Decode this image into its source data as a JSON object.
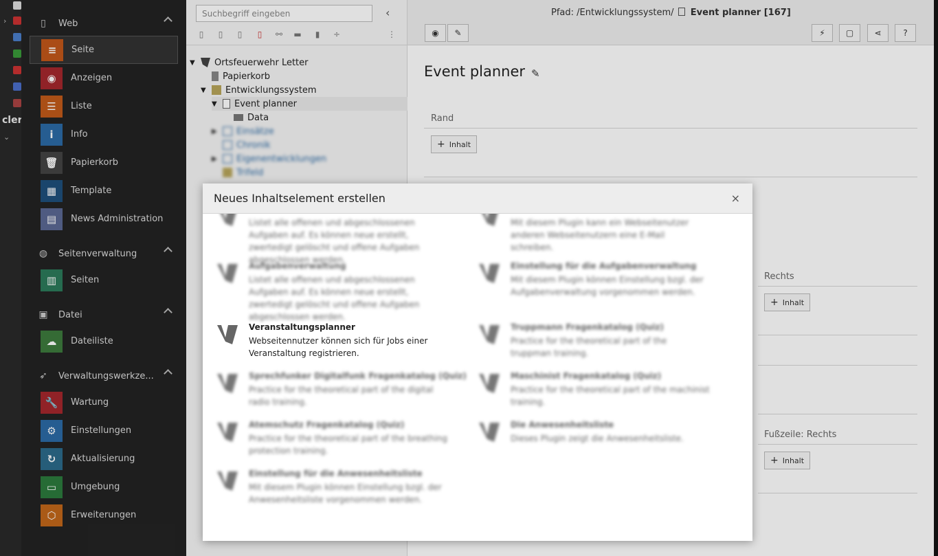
{
  "desktop": {
    "label": "cler"
  },
  "sidebar": {
    "groups": [
      {
        "label": "Web",
        "items": [
          {
            "label": "Seite",
            "color": "#c2571a",
            "active": true
          },
          {
            "label": "Anzeigen",
            "color": "#a4272d"
          },
          {
            "label": "Liste",
            "color": "#c25a1a"
          },
          {
            "label": "Info",
            "color": "#2c6aa5"
          },
          {
            "label": "Papierkorb",
            "color": "#444444"
          },
          {
            "label": "Template",
            "color": "#1e4f7b"
          },
          {
            "label": "News Administration",
            "color": "#5a6893"
          }
        ]
      },
      {
        "label": "Seitenverwaltung",
        "items": [
          {
            "label": "Seiten",
            "color": "#2c7a5a"
          }
        ]
      },
      {
        "label": "Datei",
        "items": [
          {
            "label": "Dateiliste",
            "color": "#3d7a3d"
          }
        ]
      },
      {
        "label": "Verwaltungswerkze...",
        "items": [
          {
            "label": "Wartung",
            "color": "#a4272d"
          },
          {
            "label": "Einstellungen",
            "color": "#2c6aa5"
          },
          {
            "label": "Aktualisierung",
            "color": "#2c6a8a"
          },
          {
            "label": "Umgebung",
            "color": "#2c7a3d"
          },
          {
            "label": "Erweiterungen",
            "color": "#c2671a"
          }
        ]
      }
    ]
  },
  "tree": {
    "search_placeholder": "Suchbegriff eingeben",
    "nodes": [
      {
        "label": "Ortsfeuerwehr Letter"
      },
      {
        "label": "Papierkorb"
      },
      {
        "label": "Entwicklungssystem"
      },
      {
        "label": "Event planner"
      },
      {
        "label": "Data"
      },
      {
        "label": "Einsätze"
      },
      {
        "label": "Chronik"
      },
      {
        "label": "Eigenentwicklungen"
      },
      {
        "label": "Trifeld"
      }
    ]
  },
  "docheader": {
    "path_prefix": "Pfad: /Entwicklungssystem/",
    "path_page": "Event planner [167]"
  },
  "content": {
    "title": "Event planner",
    "col_rand": "Rand",
    "col_rechts": "Rechts",
    "col_fusszeile_rechts": "Fußzeile: Rechts",
    "add_label": "Inhalt"
  },
  "modal": {
    "title": "Neues Inhaltselement erstellen",
    "close": "×",
    "elements": [
      {
        "title": "",
        "desc": "Listet alle offenen und abgeschlossenen Aufgaben auf. Es können neue erstellt, zwertedigt gelöscht und offene Aufgaben abgeschlossen werden."
      },
      {
        "title": "",
        "desc": "Mit diesem Plugin kann ein Webseitenutzer anderen Webseitenutzern eine E-Mail schreiben."
      },
      {
        "title": "Aufgabenverwaltung",
        "desc": "Listet alle offenen und abgeschlossenen Aufgaben auf. Es können neue erstellt, zwertedigt gelöscht und offene Aufgaben abgeschlossen werden."
      },
      {
        "title": "Einstellung für die Aufgabenverwaltung",
        "desc": "Mit diesem Plugin können Einstellung bzgl. der Aufgabenverwaltung vorgenommen werden."
      },
      {
        "title": "Veranstaltungsplanner",
        "desc": "Webseitennutzer können sich für Jobs einer Veranstaltung registrieren."
      },
      {
        "title": "Truppmann Fragenkatalog (Quiz)",
        "desc": "Practice for the theoretical part of the truppman training."
      },
      {
        "title": "Sprechfunker Digitalfunk Fragenkatalog (Quiz)",
        "desc": "Practice for the theoretical part of the digital radio training."
      },
      {
        "title": "Maschinist Fragenkatalog (Quiz)",
        "desc": "Practice for the theoretical part of the machinist training."
      },
      {
        "title": "Atemschutz Fragenkatalog (Quiz)",
        "desc": "Practice for the theoretical part of the breathing protection training."
      },
      {
        "title": "Die Anwesenheitsliste",
        "desc": "Dieses Plugin zeigt die Anwesenheitsliste."
      },
      {
        "title": "Einstellung für die Anwesenheitsliste",
        "desc": "Mit diesem Plugin können Einstellung bzgl. der Anwesenheitsliste vorgenommen werden."
      }
    ]
  }
}
